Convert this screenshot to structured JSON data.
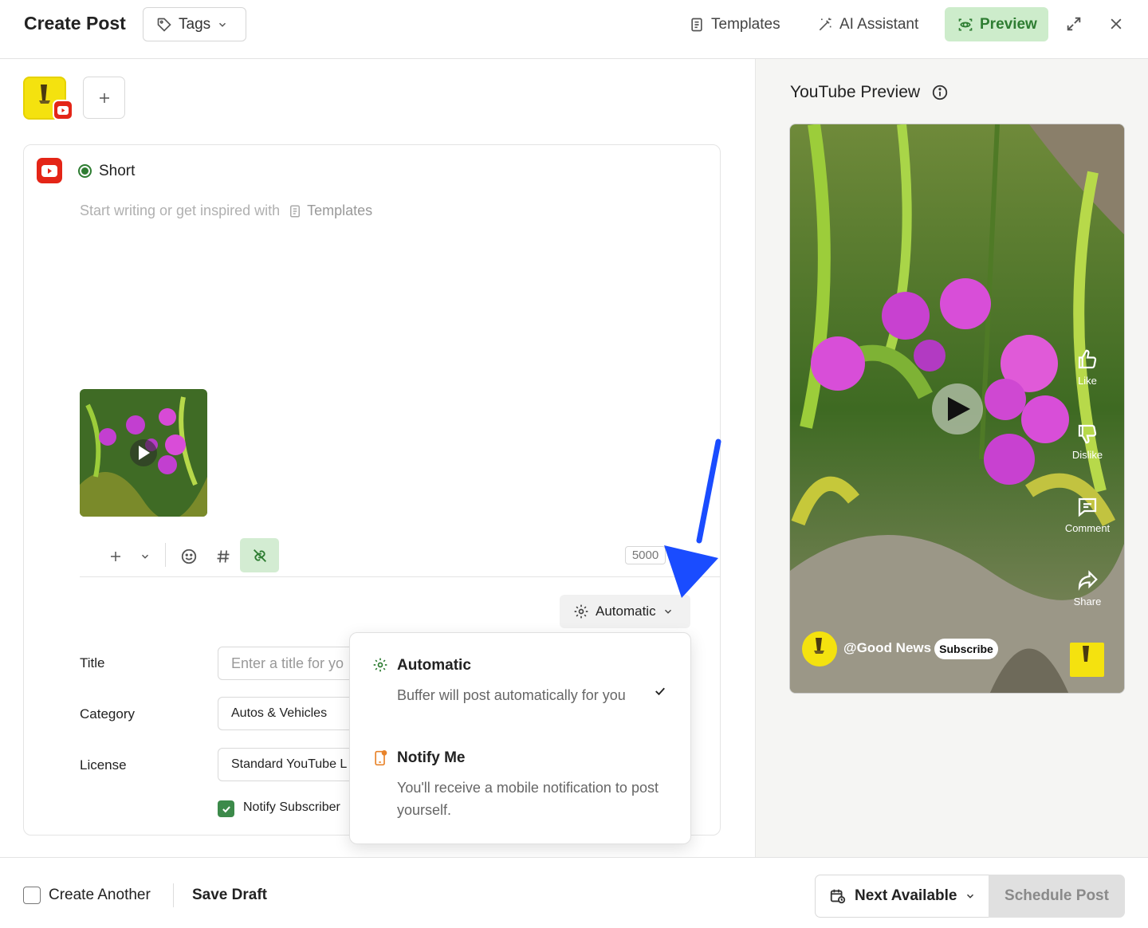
{
  "header": {
    "title": "Create Post",
    "tags_label": "Tags",
    "templates_label": "Templates",
    "ai_label": "AI Assistant",
    "preview_label": "Preview"
  },
  "editor": {
    "post_type": "Short",
    "placeholder": "Start writing or get inspired with",
    "templates_link": "Templates",
    "char_count": "5000",
    "publish_mode": "Automatic"
  },
  "fields": {
    "title_label": "Title",
    "title_placeholder": "Enter a title for yo",
    "category_label": "Category",
    "category_value": "Autos & Vehicles",
    "license_label": "License",
    "license_value": "Standard YouTube L",
    "notify_label": "Notify Subscriber"
  },
  "dropdown": {
    "options": [
      {
        "title": "Automatic",
        "desc": "Buffer will post automatically for you",
        "selected": true
      },
      {
        "title": "Notify Me",
        "desc": "You'll receive a mobile notification to post yourself.",
        "selected": false
      }
    ]
  },
  "preview": {
    "title": "YouTube Preview",
    "like": "Like",
    "dislike": "Dislike",
    "comment": "Comment",
    "share": "Share",
    "channel": "@Good News",
    "subscribe": "Subscribe"
  },
  "footer": {
    "create_another": "Create Another",
    "save_draft": "Save Draft",
    "next_available": "Next Available",
    "schedule": "Schedule Post"
  },
  "colors": {
    "accent_green": "#2e7d32",
    "preview_bg": "#cdeccb",
    "youtube_red": "#e42517",
    "arrow_blue": "#1a4cff"
  }
}
